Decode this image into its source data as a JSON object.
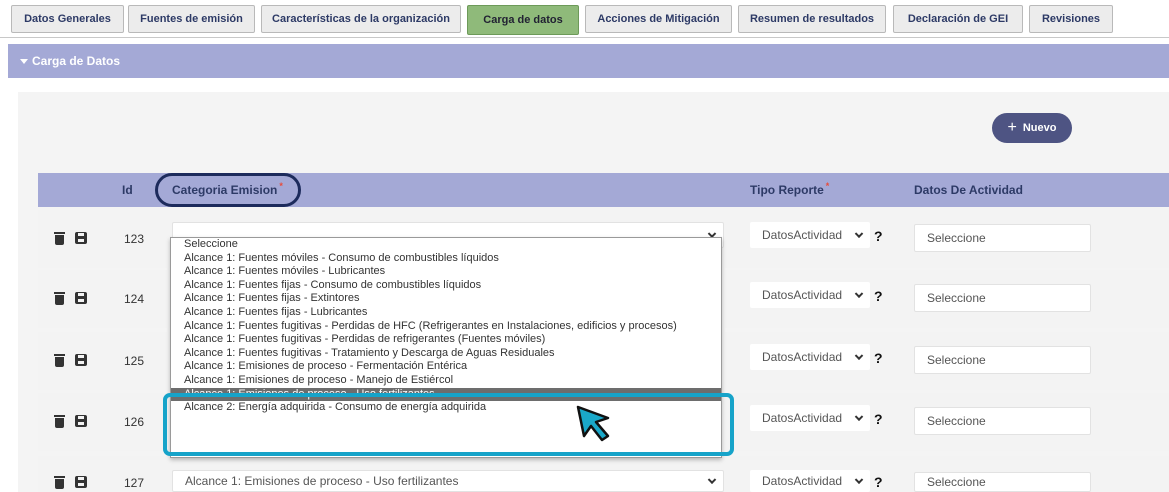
{
  "tabs": [
    {
      "label": "Datos Generales"
    },
    {
      "label": "Fuentes de emisión"
    },
    {
      "label": "Características de la organización"
    },
    {
      "label": "Carga de datos"
    },
    {
      "label": "Acciones de Mitigación"
    },
    {
      "label": "Resumen de resultados"
    },
    {
      "label": "Declaración de GEI"
    },
    {
      "label": "Revisiones"
    }
  ],
  "active_tab": "Carga de datos",
  "section": {
    "title": "Carga de Datos"
  },
  "toolbar": {
    "new_label": "Nuevo",
    "new_icon": "plus-icon"
  },
  "table": {
    "headers": {
      "id": "Id",
      "categoria": "Categoria Emision",
      "tipo": "Tipo Reporte",
      "datos": "Datos De Actividad"
    },
    "rows": [
      {
        "id": "123",
        "categoria": "",
        "tipo": "DatosActividad",
        "datos": "Seleccione"
      },
      {
        "id": "124",
        "categoria": "",
        "tipo": "DatosActividad",
        "datos": "Seleccione"
      },
      {
        "id": "125",
        "categoria": "",
        "tipo": "DatosActividad",
        "datos": "Seleccione"
      },
      {
        "id": "126",
        "categoria": "",
        "tipo": "DatosActividad",
        "datos": "Seleccione"
      },
      {
        "id": "127",
        "categoria": "Alcance 1: Emisiones de proceso - Uso fertilizantes",
        "tipo": "DatosActividad",
        "datos": "Seleccione"
      }
    ],
    "help_glyph": "?"
  },
  "dropdown": {
    "options": [
      "Seleccione",
      "Alcance 1: Fuentes móviles - Consumo de combustibles líquidos",
      "Alcance 1: Fuentes móviles - Lubricantes",
      "Alcance 1: Fuentes fijas - Consumo de combustibles líquidos",
      "Alcance 1: Fuentes fijas - Extintores",
      "Alcance 1: Fuentes fijas - Lubricantes",
      "Alcance 1: Fuentes fugitivas - Perdidas de HFC (Refrigerantes en Instalaciones, edificios y procesos)",
      "Alcance 1: Fuentes fugitivas - Perdidas de refrigerantes (Fuentes móviles)",
      "Alcance 1: Fuentes fugitivas - Tratamiento y Descarga de Aguas Residuales",
      "Alcance 1: Emisiones de proceso - Fermentación Entérica",
      "Alcance 1: Emisiones de proceso - Manejo de Estiércol",
      "Alcance 1: Emisiones de proceso - Uso fertilizantes",
      "Alcance 2: Energía adquirida - Consumo de energía adquirida"
    ],
    "selected": "Alcance 1: Emisiones de proceso - Uso fertilizantes"
  },
  "colors": {
    "header_bg": "#a4a9d6",
    "active_tab": "#8fba7a",
    "button": "#4e5483",
    "highlight": "#16a3c9"
  }
}
